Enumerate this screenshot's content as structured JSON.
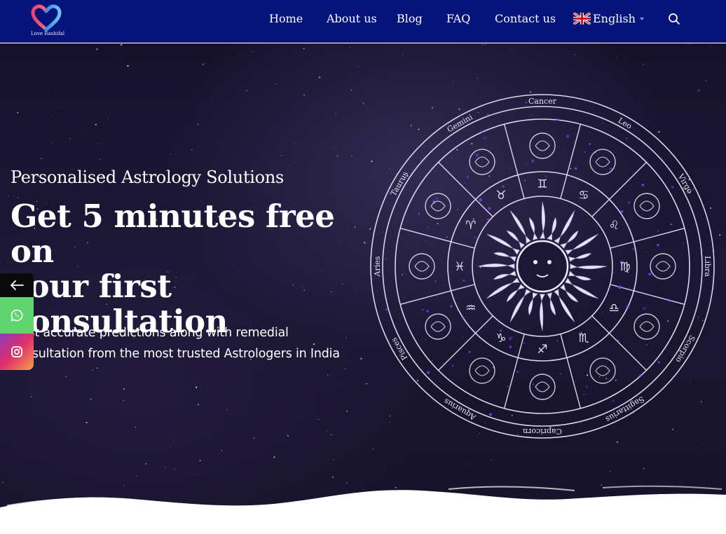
{
  "header": {
    "logo_text": "Love Rashifal",
    "nav": [
      {
        "label": "Home"
      },
      {
        "label": "About us"
      },
      {
        "label": "Blog"
      },
      {
        "label": "FAQ"
      },
      {
        "label": "Contact us"
      }
    ],
    "language": {
      "label": "English",
      "flag": "uk-flag-icon"
    },
    "search_icon": "search-icon"
  },
  "hero": {
    "eyebrow": "Personalised Astrology Solutions",
    "headline_line1": "Get 5 minutes free on",
    "headline_line2": "your first",
    "headline_line3": "consultation",
    "subtext_line1": "Most accurate predictions along with remedial",
    "subtext_line2": "consultation from the most trusted Astrologers in India",
    "zodiac_labels": [
      "Cancer",
      "Leo",
      "Virgo",
      "Libra",
      "Scorpio",
      "Sagittarius",
      "Capricorn",
      "Aquarius",
      "Pisces",
      "Aries",
      "Taurus",
      "Gemini"
    ]
  },
  "social": {
    "back_icon": "arrow-left-icon",
    "whatsapp_icon": "whatsapp-icon",
    "instagram_icon": "instagram-icon"
  },
  "colors": {
    "header_bg": "#05137a",
    "hero_bg": "#1c1735",
    "whatsapp": "#5fd36e"
  }
}
